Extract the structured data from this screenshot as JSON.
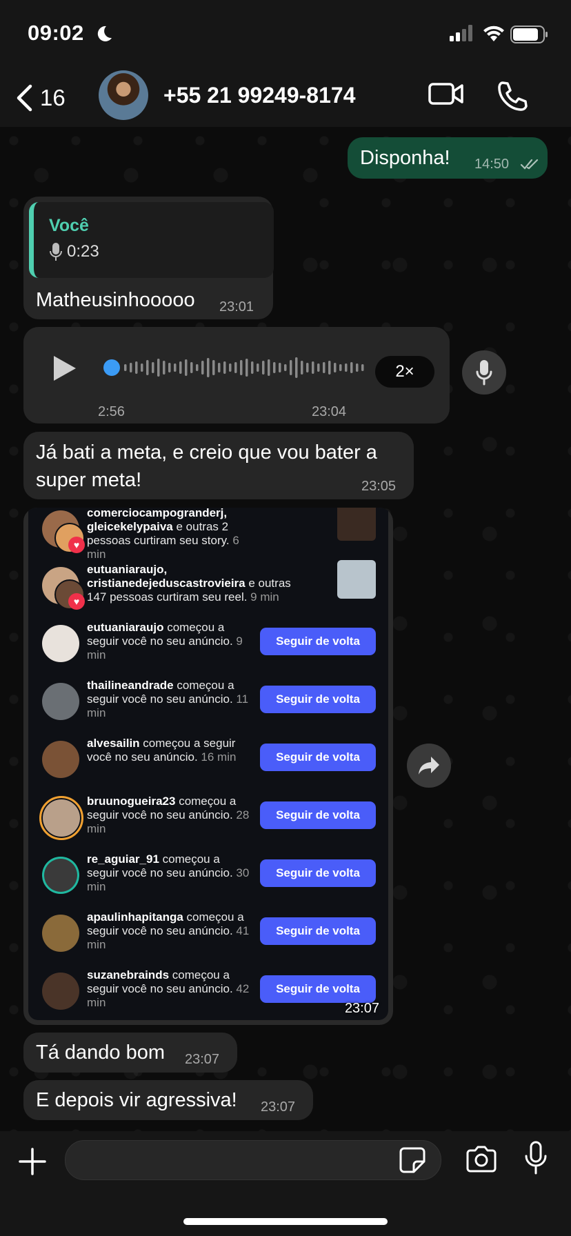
{
  "status_bar": {
    "time": "09:02"
  },
  "header": {
    "back_count": "16",
    "contact": "+55 21 99249-8174"
  },
  "messages": {
    "m1": {
      "text": "Disponha!",
      "time": "14:50"
    },
    "m2": {
      "reply_author": "Você",
      "reply_duration": "0:23",
      "text": "Matheusinhooooo",
      "time": "23:01"
    },
    "m3": {
      "duration": "2:56",
      "time": "23:04",
      "speed": "2×"
    },
    "m4": {
      "text": "Já bati a meta, e creio que vou bater a super meta!",
      "time": "23:05"
    },
    "m5": {
      "time": "23:07"
    },
    "m6": {
      "text": "Tá dando bom",
      "time": "23:07"
    },
    "m7": {
      "text": "E depois vir agressiva!",
      "time": "23:07"
    }
  },
  "screenshot": {
    "follow_label": "Seguir de volta",
    "likes": [
      {
        "users": "comerciocampogranderj, gleicekelypaiva",
        "rest": " e outras 2 pessoas curtiram seu story.",
        "ago": " 6 min"
      },
      {
        "users": "eutuaniaraujo, cristianedejeduscastrovieira",
        "rest": " e outras 147 pessoas curtiram seu reel.",
        "ago": " 9 min"
      }
    ],
    "follows": [
      {
        "user": "eutuaniaraujo",
        "rest": " começou a seguir você no seu anúncio.",
        "ago": " 9 min"
      },
      {
        "user": "thailineandrade",
        "rest": " começou a seguir você no seu anúncio.",
        "ago": " 11 min"
      },
      {
        "user": "alvesailin",
        "rest": " começou a seguir você no seu anúncio.",
        "ago": " 16 min"
      },
      {
        "user": "bruunogueira23",
        "rest": " começou a seguir você no seu anúncio.",
        "ago": " 28 min"
      },
      {
        "user": "re_aguiar_91",
        "rest": " começou a seguir você no seu anúncio.",
        "ago": " 30 min"
      },
      {
        "user": "apaulinhapitanga",
        "rest": " começou a seguir você no seu anúncio.",
        "ago": " 41 min"
      },
      {
        "user": "suzanebrainds",
        "rest": " começou a seguir você no seu anúncio.",
        "ago": " 42 min"
      }
    ]
  },
  "colors": {
    "outgoing": "#144d37",
    "incoming": "#262626",
    "accent": "#4fcfb0",
    "follow_button": "#4a5df9",
    "voice_dot": "#3b9bf5"
  },
  "icons": [
    "moon-icon",
    "signal-icon",
    "wifi-icon",
    "battery-icon",
    "back-icon",
    "video-icon",
    "phone-icon",
    "play-icon",
    "mic-icon",
    "forward-icon",
    "plus-icon",
    "sticker-icon",
    "camera-icon",
    "read-check-icon",
    "heart-icon"
  ]
}
